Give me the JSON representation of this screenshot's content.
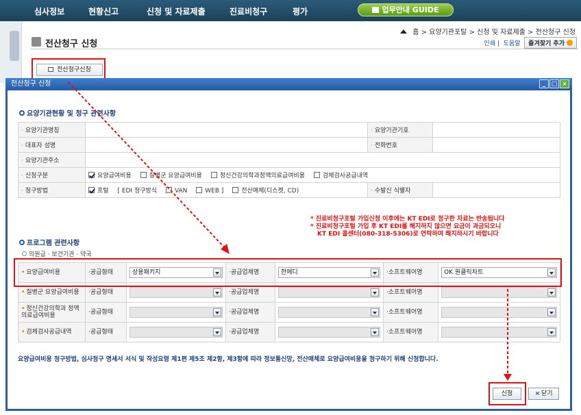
{
  "topnav": {
    "items": [
      "심사정보",
      "현황신고",
      "신청 및 자료제출",
      "진료비청구",
      "평가"
    ],
    "guide": "업무안내 GUIDE"
  },
  "page": {
    "breadcrumb": "홈 > 요양기관포탈 > 신청 및 자료제출 > 전산청구 신청",
    "title": "전산청구 신청",
    "print": "인쇄",
    "help": "도움말",
    "favorite": "즐겨찾기 추가",
    "request_button": "전산청구신청"
  },
  "dialog": {
    "title": "전산청구 신청",
    "section1": "요양기관현황 및 청구 관련사항",
    "labels": {
      "org_name": "요양기관명칭",
      "org_code": "요양기관기호",
      "ceo_name": "대표자 성명",
      "phone": "전화번호",
      "address": "요양기관주소",
      "apply_type": "신청구분",
      "claim_method": "청구방법",
      "receiver_id": "수발신 식별자"
    },
    "apply_options": [
      {
        "label": "요양급여비용",
        "checked": true
      },
      {
        "label": "질병군 요양급여비용",
        "checked": false
      },
      {
        "label": "정신건강의학과정액의료급여비용",
        "checked": false
      },
      {
        "label": "검체검사공급내역",
        "checked": false
      }
    ],
    "claim_options": {
      "portal": {
        "label": "포털",
        "checked": true
      },
      "bracket_open": "[ EDI 청구방식",
      "van": {
        "label": "VAN",
        "checked": false
      },
      "web": {
        "label": "WEB ]",
        "checked": false
      },
      "media": {
        "label": "전산매체(디스켓, CD)",
        "checked": false
      }
    },
    "notices": [
      "* 진료비청구포털 가입신청 이후에는 KT EDI로 청구한 자료는 반송됩니다",
      "* 진료비청구포털 가입 후 KT EDI를 해지하지 않으면 요금이 과금되오니",
      "KT EDI 콜센터(080-318-5306)로 연락하여 해지하시기 바랍니다"
    ],
    "section2": "프로그램 관련사항",
    "subtab": "의원급 · 보건기관 · 약국",
    "col_supply_type": "공급형태",
    "col_vendor": "공급업체명",
    "col_software": "소프트웨어명",
    "program_rows": [
      {
        "label": "요양급여비용",
        "supply_type": "상용패키지",
        "vendor": "한메디",
        "software": "OK 원클릭차트",
        "enabled": true
      },
      {
        "label": "질병군 요양급여비용",
        "supply_type": "",
        "vendor": "",
        "software": "",
        "enabled": false
      },
      {
        "label": "정신건강의학과 정액의료급여비용",
        "supply_type": "",
        "vendor": "",
        "software": "",
        "enabled": false
      },
      {
        "label": "검체검사공급내역",
        "supply_type": "",
        "vendor": "",
        "software": "",
        "enabled": false
      }
    ],
    "bottom_note": "요양급여비용 청구방법, 심사청구 명세서 서식 및 작성요령 제1편 제5조 제2항, 제3항에 따라 정보통신망, 전산매체로 요양급여비용을 청구하기 위해 신청합니다.",
    "apply_button": "신청",
    "close_button": "닫기"
  }
}
